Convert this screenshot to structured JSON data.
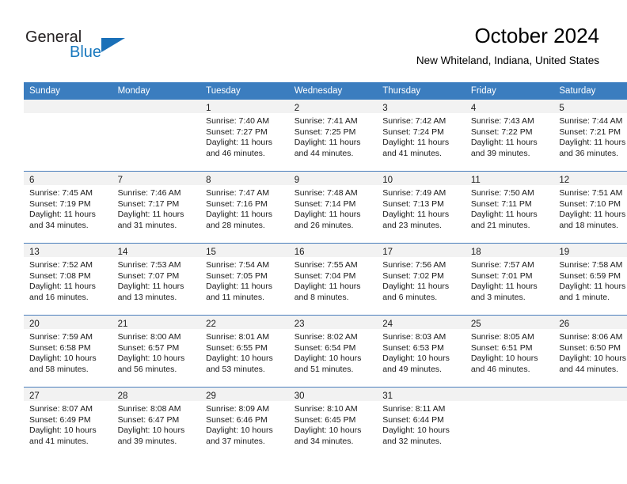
{
  "brand": {
    "word1": "General",
    "word2": "Blue",
    "logo_icon": "triangle-icon",
    "accent_color": "#1a70b8"
  },
  "header": {
    "title": "October 2024",
    "subtitle": "New Whiteland, Indiana, United States"
  },
  "calendar": {
    "header_bg": "#3b7dbf",
    "daynum_band_bg": "#f2f2f2",
    "row_divider": "#4a7ebb",
    "weekday_headers": [
      "Sunday",
      "Monday",
      "Tuesday",
      "Wednesday",
      "Thursday",
      "Friday",
      "Saturday"
    ],
    "weeks": [
      [
        {
          "day": "",
          "lines": []
        },
        {
          "day": "",
          "lines": []
        },
        {
          "day": "1",
          "lines": [
            "Sunrise: 7:40 AM",
            "Sunset: 7:27 PM",
            "Daylight: 11 hours",
            "and 46 minutes."
          ]
        },
        {
          "day": "2",
          "lines": [
            "Sunrise: 7:41 AM",
            "Sunset: 7:25 PM",
            "Daylight: 11 hours",
            "and 44 minutes."
          ]
        },
        {
          "day": "3",
          "lines": [
            "Sunrise: 7:42 AM",
            "Sunset: 7:24 PM",
            "Daylight: 11 hours",
            "and 41 minutes."
          ]
        },
        {
          "day": "4",
          "lines": [
            "Sunrise: 7:43 AM",
            "Sunset: 7:22 PM",
            "Daylight: 11 hours",
            "and 39 minutes."
          ]
        },
        {
          "day": "5",
          "lines": [
            "Sunrise: 7:44 AM",
            "Sunset: 7:21 PM",
            "Daylight: 11 hours",
            "and 36 minutes."
          ]
        }
      ],
      [
        {
          "day": "6",
          "lines": [
            "Sunrise: 7:45 AM",
            "Sunset: 7:19 PM",
            "Daylight: 11 hours",
            "and 34 minutes."
          ]
        },
        {
          "day": "7",
          "lines": [
            "Sunrise: 7:46 AM",
            "Sunset: 7:17 PM",
            "Daylight: 11 hours",
            "and 31 minutes."
          ]
        },
        {
          "day": "8",
          "lines": [
            "Sunrise: 7:47 AM",
            "Sunset: 7:16 PM",
            "Daylight: 11 hours",
            "and 28 minutes."
          ]
        },
        {
          "day": "9",
          "lines": [
            "Sunrise: 7:48 AM",
            "Sunset: 7:14 PM",
            "Daylight: 11 hours",
            "and 26 minutes."
          ]
        },
        {
          "day": "10",
          "lines": [
            "Sunrise: 7:49 AM",
            "Sunset: 7:13 PM",
            "Daylight: 11 hours",
            "and 23 minutes."
          ]
        },
        {
          "day": "11",
          "lines": [
            "Sunrise: 7:50 AM",
            "Sunset: 7:11 PM",
            "Daylight: 11 hours",
            "and 21 minutes."
          ]
        },
        {
          "day": "12",
          "lines": [
            "Sunrise: 7:51 AM",
            "Sunset: 7:10 PM",
            "Daylight: 11 hours",
            "and 18 minutes."
          ]
        }
      ],
      [
        {
          "day": "13",
          "lines": [
            "Sunrise: 7:52 AM",
            "Sunset: 7:08 PM",
            "Daylight: 11 hours",
            "and 16 minutes."
          ]
        },
        {
          "day": "14",
          "lines": [
            "Sunrise: 7:53 AM",
            "Sunset: 7:07 PM",
            "Daylight: 11 hours",
            "and 13 minutes."
          ]
        },
        {
          "day": "15",
          "lines": [
            "Sunrise: 7:54 AM",
            "Sunset: 7:05 PM",
            "Daylight: 11 hours",
            "and 11 minutes."
          ]
        },
        {
          "day": "16",
          "lines": [
            "Sunrise: 7:55 AM",
            "Sunset: 7:04 PM",
            "Daylight: 11 hours",
            "and 8 minutes."
          ]
        },
        {
          "day": "17",
          "lines": [
            "Sunrise: 7:56 AM",
            "Sunset: 7:02 PM",
            "Daylight: 11 hours",
            "and 6 minutes."
          ]
        },
        {
          "day": "18",
          "lines": [
            "Sunrise: 7:57 AM",
            "Sunset: 7:01 PM",
            "Daylight: 11 hours",
            "and 3 minutes."
          ]
        },
        {
          "day": "19",
          "lines": [
            "Sunrise: 7:58 AM",
            "Sunset: 6:59 PM",
            "Daylight: 11 hours",
            "and 1 minute."
          ]
        }
      ],
      [
        {
          "day": "20",
          "lines": [
            "Sunrise: 7:59 AM",
            "Sunset: 6:58 PM",
            "Daylight: 10 hours",
            "and 58 minutes."
          ]
        },
        {
          "day": "21",
          "lines": [
            "Sunrise: 8:00 AM",
            "Sunset: 6:57 PM",
            "Daylight: 10 hours",
            "and 56 minutes."
          ]
        },
        {
          "day": "22",
          "lines": [
            "Sunrise: 8:01 AM",
            "Sunset: 6:55 PM",
            "Daylight: 10 hours",
            "and 53 minutes."
          ]
        },
        {
          "day": "23",
          "lines": [
            "Sunrise: 8:02 AM",
            "Sunset: 6:54 PM",
            "Daylight: 10 hours",
            "and 51 minutes."
          ]
        },
        {
          "day": "24",
          "lines": [
            "Sunrise: 8:03 AM",
            "Sunset: 6:53 PM",
            "Daylight: 10 hours",
            "and 49 minutes."
          ]
        },
        {
          "day": "25",
          "lines": [
            "Sunrise: 8:05 AM",
            "Sunset: 6:51 PM",
            "Daylight: 10 hours",
            "and 46 minutes."
          ]
        },
        {
          "day": "26",
          "lines": [
            "Sunrise: 8:06 AM",
            "Sunset: 6:50 PM",
            "Daylight: 10 hours",
            "and 44 minutes."
          ]
        }
      ],
      [
        {
          "day": "27",
          "lines": [
            "Sunrise: 8:07 AM",
            "Sunset: 6:49 PM",
            "Daylight: 10 hours",
            "and 41 minutes."
          ]
        },
        {
          "day": "28",
          "lines": [
            "Sunrise: 8:08 AM",
            "Sunset: 6:47 PM",
            "Daylight: 10 hours",
            "and 39 minutes."
          ]
        },
        {
          "day": "29",
          "lines": [
            "Sunrise: 8:09 AM",
            "Sunset: 6:46 PM",
            "Daylight: 10 hours",
            "and 37 minutes."
          ]
        },
        {
          "day": "30",
          "lines": [
            "Sunrise: 8:10 AM",
            "Sunset: 6:45 PM",
            "Daylight: 10 hours",
            "and 34 minutes."
          ]
        },
        {
          "day": "31",
          "lines": [
            "Sunrise: 8:11 AM",
            "Sunset: 6:44 PM",
            "Daylight: 10 hours",
            "and 32 minutes."
          ]
        },
        {
          "day": "",
          "lines": []
        },
        {
          "day": "",
          "lines": []
        }
      ]
    ]
  }
}
